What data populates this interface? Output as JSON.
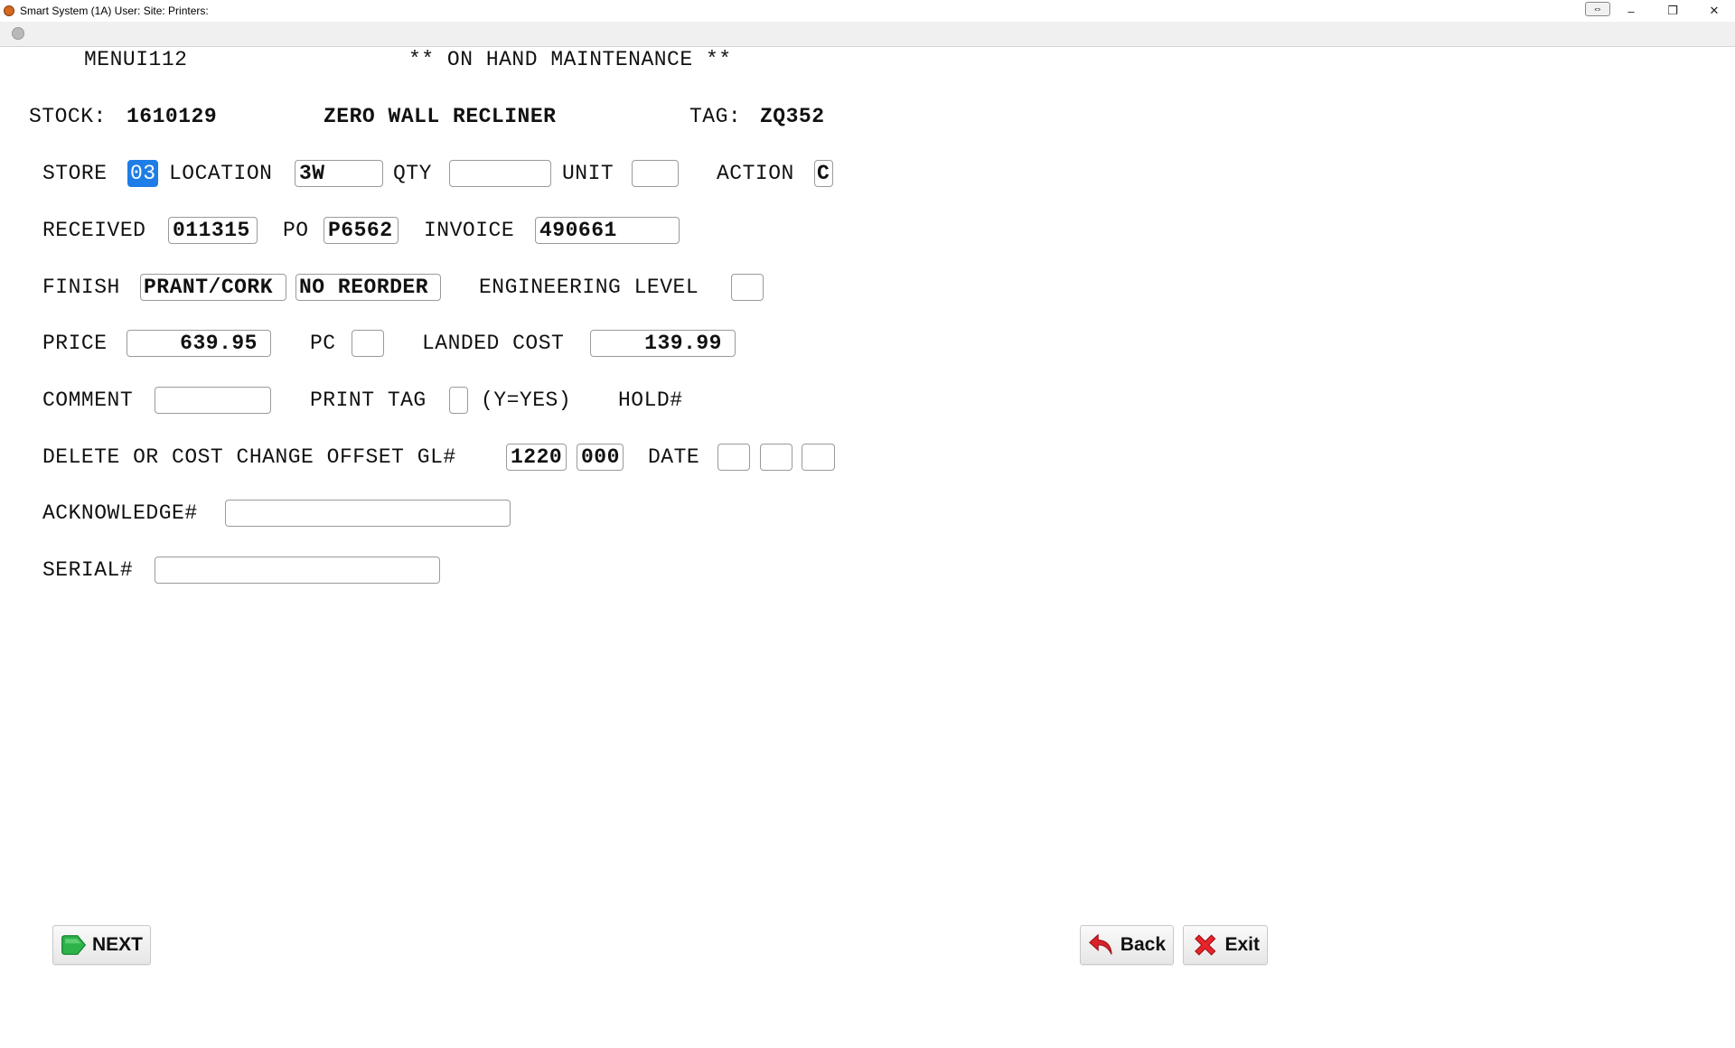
{
  "window": {
    "title": "Smart System (1A) User: Site: Printers:",
    "controls": {
      "minimize": "–",
      "maximize": "❐",
      "close": "✕",
      "resize": "⇔"
    }
  },
  "header": {
    "menu_id": "MENUI112",
    "screen_title": "** ON HAND MAINTENANCE **"
  },
  "stock": {
    "label": "STOCK:",
    "number": "1610129",
    "description": "ZERO WALL RECLINER",
    "tag_label": "TAG:",
    "tag": "ZQ352"
  },
  "form": {
    "store_label": "STORE",
    "store": "03",
    "location_label": "LOCATION",
    "location": "3W",
    "qty_label": "QTY",
    "qty": "",
    "unit_label": "UNIT",
    "unit": "",
    "action_label": "ACTION",
    "action": "C",
    "received_label": "RECEIVED",
    "received": "011315",
    "po_label": "PO",
    "po": "P6562",
    "invoice_label": "INVOICE",
    "invoice": "490661",
    "finish_label": "FINISH",
    "finish": "PRANT/CORK",
    "reorder": "NO REORDER",
    "engineering_label": "ENGINEERING LEVEL",
    "engineering": "",
    "price_label": "PRICE",
    "price": "639.95",
    "pc_label": "PC",
    "pc": "",
    "landed_cost_label": "LANDED COST",
    "landed_cost": "139.99",
    "comment_label": "COMMENT",
    "comment": "",
    "print_tag_label": "PRINT TAG",
    "print_tag": "",
    "print_tag_hint": "(Y=YES)",
    "hold_label": "HOLD#",
    "gl_label": "DELETE OR COST CHANGE OFFSET GL#",
    "gl_1": "1220",
    "gl_2": "000",
    "date_label": "DATE",
    "date_1": "",
    "date_2": "",
    "date_3": "",
    "acknowledge_label": "ACKNOWLEDGE#",
    "acknowledge": "",
    "serial_label": "SERIAL#",
    "serial": ""
  },
  "buttons": {
    "next": "NEXT",
    "back": "Back",
    "exit": "Exit"
  },
  "colors": {
    "selection": "#1e7de6",
    "next_icon": "#2db34a",
    "back_icon": "#d9232a",
    "exit_icon": "#e8242b"
  }
}
